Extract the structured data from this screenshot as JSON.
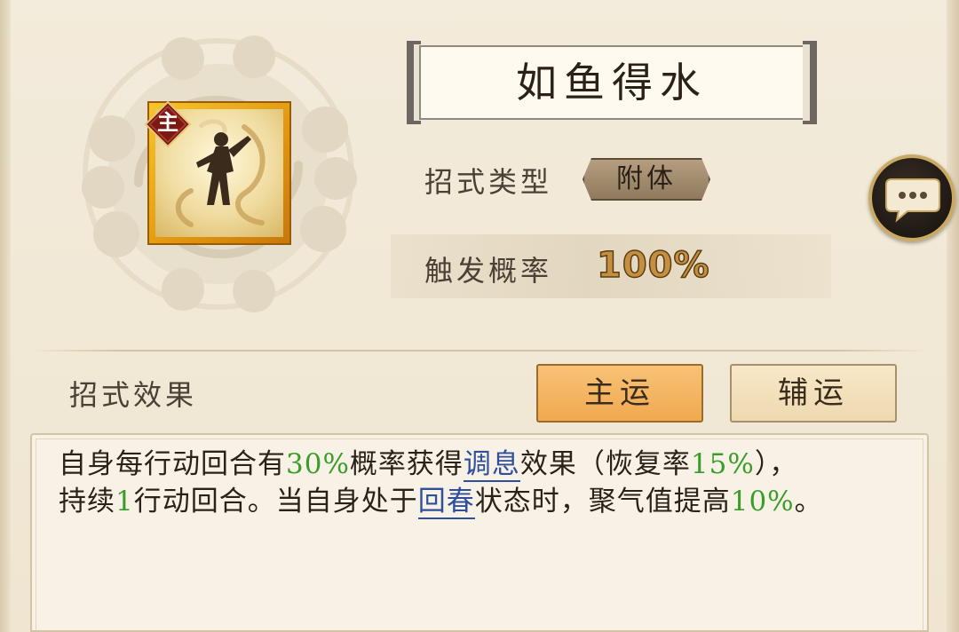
{
  "skill": {
    "title": "如鱼得水",
    "badge": "主"
  },
  "info": {
    "type_label": "招式类型",
    "type_value": "附体",
    "prob_label": "触发概率",
    "prob_value": "100%"
  },
  "effect": {
    "label": "招式效果",
    "tabs": [
      {
        "label": "主运",
        "selected": true
      },
      {
        "label": "辅运",
        "selected": false
      }
    ],
    "description": [
      {
        "text": "自身每行动回合有",
        "style": "normal"
      },
      {
        "text": "30%",
        "style": "green"
      },
      {
        "text": "概率获得",
        "style": "normal"
      },
      {
        "text": "调息",
        "style": "blue"
      },
      {
        "text": "效果（恢复率",
        "style": "normal"
      },
      {
        "text": "15%",
        "style": "green"
      },
      {
        "text": "），",
        "style": "normal"
      },
      {
        "text": "持续",
        "style": "normal"
      },
      {
        "text": "1",
        "style": "green"
      },
      {
        "text": "行动回合。当自身处于",
        "style": "normal"
      },
      {
        "text": "回春",
        "style": "blue"
      },
      {
        "text": "状态时，聚气值提高",
        "style": "normal"
      },
      {
        "text": "10%",
        "style": "green"
      },
      {
        "text": "。",
        "style": "normal"
      }
    ]
  },
  "icons": {
    "chat": "chat-bubble-icon",
    "emblem": "cloud-emblem-icon",
    "skill": "dancer-silhouette-icon"
  },
  "colors": {
    "accent_green": "#3a9d2a",
    "link_blue": "#2f4f9c",
    "tab_selected": "#f0a94f",
    "prob_gold": "#c48f40"
  }
}
